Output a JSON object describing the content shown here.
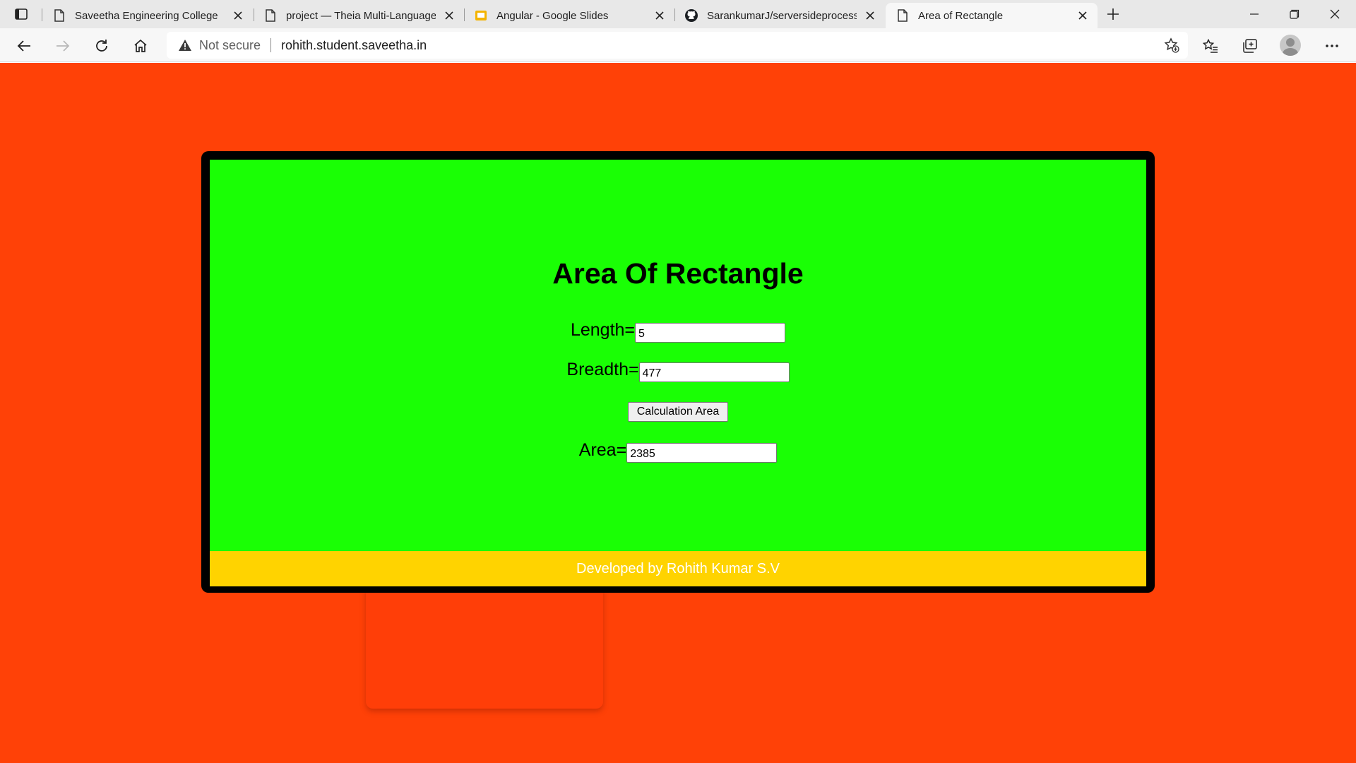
{
  "browser": {
    "tabs": [
      {
        "title": "Saveetha Engineering College",
        "icon": "page-icon",
        "active": false
      },
      {
        "title": "project — Theia Multi-Language",
        "icon": "page-icon",
        "active": false
      },
      {
        "title": "Angular - Google Slides",
        "icon": "google-slides-icon",
        "active": false
      },
      {
        "title": "SarankumarJ/serversideprocessin",
        "icon": "github-icon",
        "active": false
      },
      {
        "title": "Area of Rectangle",
        "icon": "page-icon",
        "active": true
      }
    ],
    "security_label": "Not secure",
    "url": "rohith.student.saveetha.in",
    "colors": {
      "tab_strip": "#e8e8e8",
      "toolbar": "#f7f7f7"
    }
  },
  "page": {
    "heading": "Area Of Rectangle",
    "length_label": "Length=",
    "length_value": "5",
    "breadth_label": "Breadth=",
    "breadth_value": "477",
    "button_label": "Calculation Area",
    "area_label": "Area=",
    "area_value": "2385",
    "footer": "Developed by Rohith Kumar S.V",
    "colors": {
      "background": "#ff4107",
      "frame": "#000000",
      "content": "#1aff05",
      "footer": "#ffd300"
    }
  }
}
